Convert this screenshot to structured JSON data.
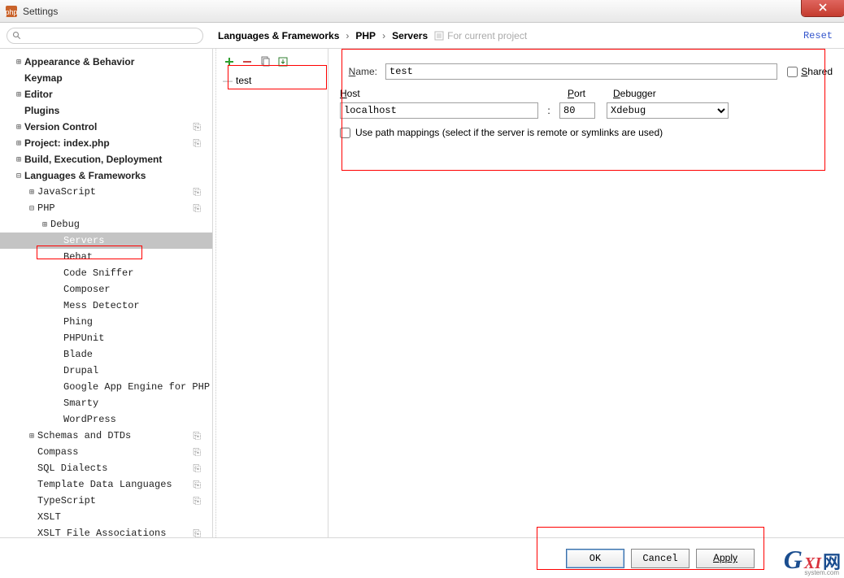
{
  "window": {
    "title": "Settings",
    "close_icon": "close"
  },
  "breadcrumb": {
    "seg1": "Languages & Frameworks",
    "seg2": "PHP",
    "seg3": "Servers",
    "note": "For current project",
    "reset": "Reset"
  },
  "tree": {
    "appearance": "Appearance & Behavior",
    "keymap": "Keymap",
    "editor": "Editor",
    "plugins": "Plugins",
    "vcs": "Version Control",
    "project": "Project: index.php",
    "build": "Build, Execution, Deployment",
    "lang": "Languages & Frameworks",
    "js": "JavaScript",
    "php": "PHP",
    "debug": "Debug",
    "servers": "Servers",
    "behat": "Behat",
    "sniffer": "Code Sniffer",
    "composer": "Composer",
    "mess": "Mess Detector",
    "phing": "Phing",
    "phpunit": "PHPUnit",
    "blade": "Blade",
    "drupal": "Drupal",
    "gae": "Google App Engine for PHP",
    "smarty": "Smarty",
    "wordpress": "WordPress",
    "schemas": "Schemas and DTDs",
    "compass": "Compass",
    "sql": "SQL Dialects",
    "template": "Template Data Languages",
    "ts": "TypeScript",
    "xslt": "XSLT",
    "xsltfa": "XSLT File Associations"
  },
  "servers": {
    "item": "test"
  },
  "form": {
    "name_label": "Name:",
    "name_value": "test",
    "shared_label": "Shared",
    "host_label": "Host",
    "host_value": "localhost",
    "port_label": "Port",
    "port_value": "80",
    "debugger_label": "Debugger",
    "debugger_value": "Xdebug",
    "path_label": "Use path mappings (select if the server is remote or symlinks are used)"
  },
  "footer": {
    "ok": "OK",
    "cancel": "Cancel",
    "apply": "Apply"
  },
  "watermark": {
    "g": "G",
    "xi": "XI",
    "zh": "网",
    "sub": "system.com"
  }
}
